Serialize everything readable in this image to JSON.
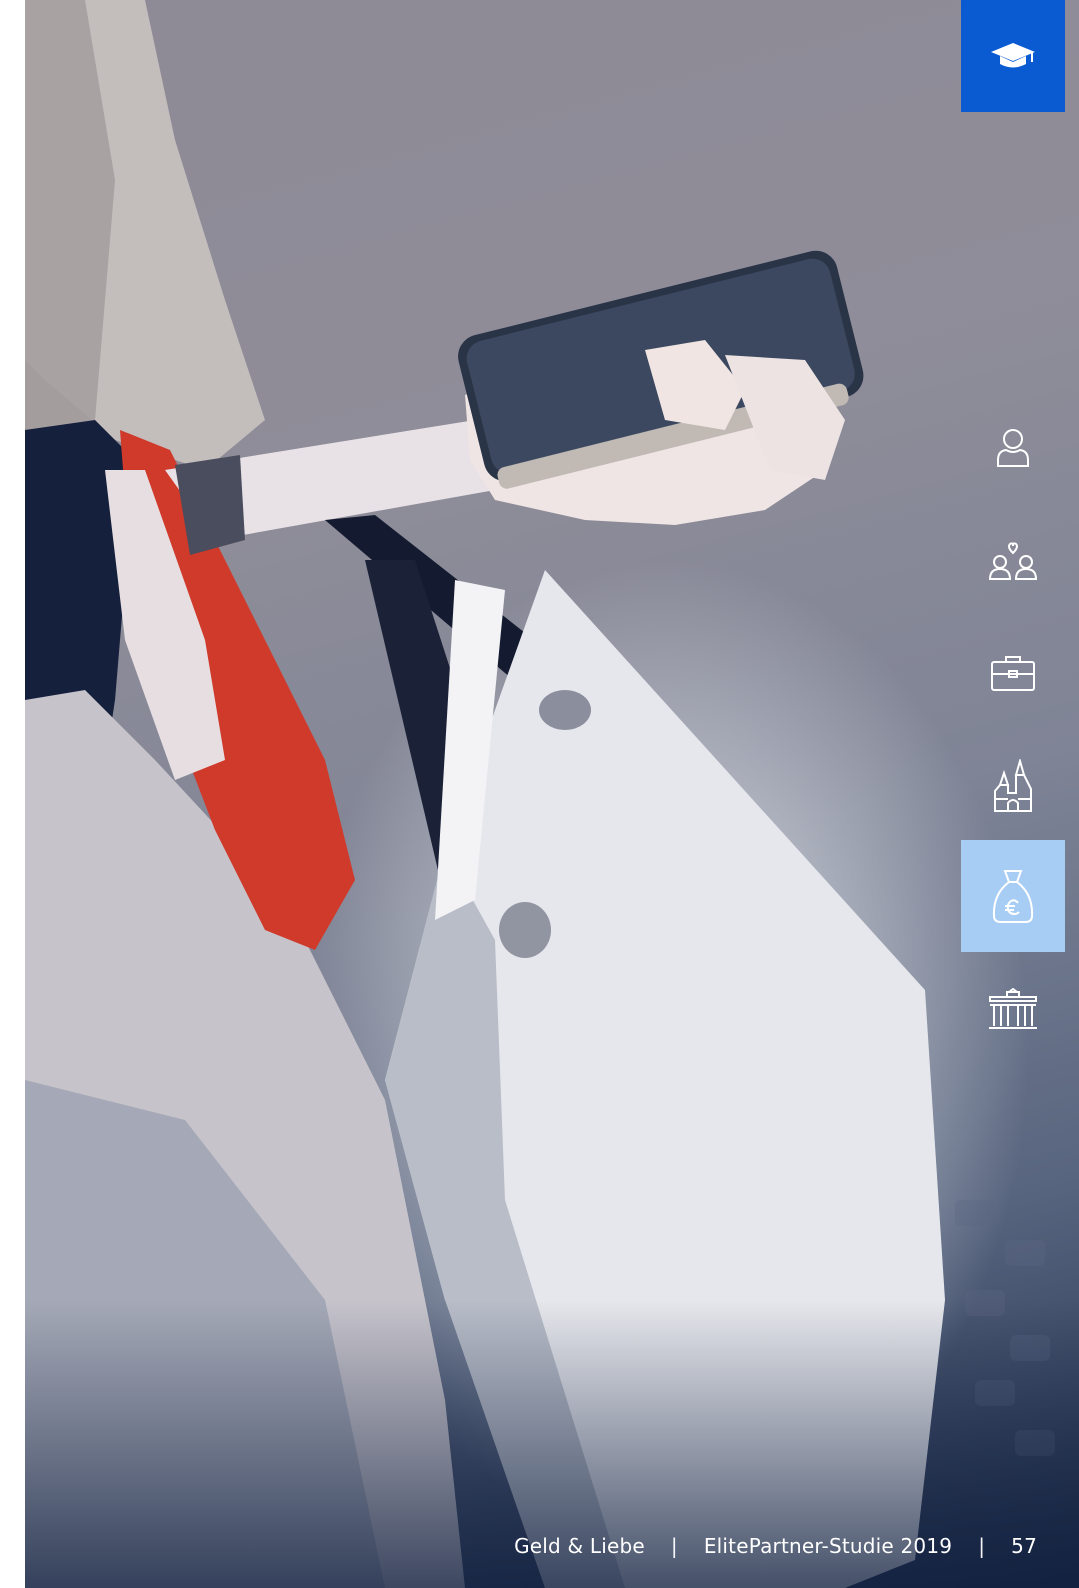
{
  "nav": {
    "items": [
      {
        "icon": "graduation-cap-icon",
        "state": "active-dark"
      },
      {
        "icon": "person-icon",
        "state": "default"
      },
      {
        "icon": "couple-heart-icon",
        "state": "default"
      },
      {
        "icon": "briefcase-icon",
        "state": "default"
      },
      {
        "icon": "castle-icon",
        "state": "default"
      },
      {
        "icon": "money-bag-euro-icon",
        "state": "active-light"
      },
      {
        "icon": "brandenburg-gate-icon",
        "state": "default"
      }
    ],
    "colors": {
      "dark_active": "#0a5ad2",
      "light_active": "#a8cdf4",
      "icon": "#ffffff"
    }
  },
  "footer": {
    "section": "Geld & Liebe",
    "separator": "|",
    "study": "ElitePartner-Studie 2019",
    "page": "57"
  }
}
